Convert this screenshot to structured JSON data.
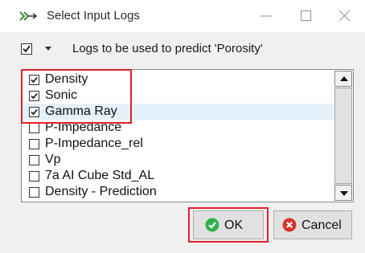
{
  "window": {
    "title": "Select Input Logs",
    "minimize_icon": "minimize-icon",
    "maximize_icon": "maximize-icon",
    "close_icon": "close-icon"
  },
  "toolbar": {
    "label": "Logs to be used to predict 'Porosity'",
    "select_all_checked": true,
    "dropdown_icon": "dropdown-triangle-icon"
  },
  "logs": [
    {
      "label": "Density",
      "checked": true
    },
    {
      "label": "Sonic",
      "checked": true
    },
    {
      "label": "Gamma Ray",
      "checked": true
    },
    {
      "label": "P-Impedance",
      "checked": false
    },
    {
      "label": "P-Impedance_rel",
      "checked": false
    },
    {
      "label": "Vp",
      "checked": false
    },
    {
      "label": "7a AI Cube Std_AL",
      "checked": false
    },
    {
      "label": "Density - Prediction",
      "checked": false
    }
  ],
  "buttons": {
    "ok_label": "OK",
    "cancel_label": "Cancel"
  },
  "colors": {
    "highlight_red": "#e0202a",
    "ok_green": "#2fb24a",
    "cancel_red": "#d8322a",
    "selected_row": "#e5f1fb"
  }
}
